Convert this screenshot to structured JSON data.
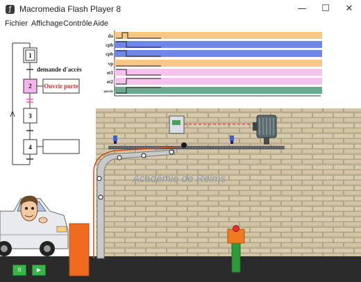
{
  "window": {
    "title": "Macromedia Flash Player 8",
    "app_icon": "flash-icon",
    "controls": {
      "minimize": "—",
      "maximize": "☐",
      "close": "✕"
    }
  },
  "menu": {
    "items": [
      "Fichier",
      "Affichage",
      "Contrôle",
      "Aide"
    ]
  },
  "grafcet": {
    "steps": [
      "1",
      "2",
      "3",
      "4"
    ],
    "transition_1": "demande d'accès",
    "action_2": "Ouvrir porte",
    "action_4": ""
  },
  "chronogram": {
    "signals": [
      {
        "label": "da",
        "color": "#f7c78a"
      },
      {
        "label": "cph",
        "color": "#6f87e8"
      },
      {
        "label": "cpb",
        "color": "#6f87e8"
      },
      {
        "label": "vp",
        "color": "#f7c78a"
      },
      {
        "label": "et1",
        "color": "#f6c3ee"
      },
      {
        "label": "et2",
        "color": "#f6c3ee"
      },
      {
        "label": "ouvrir",
        "color": "#6aaa8e"
      }
    ]
  },
  "scene": {
    "watermark": "Académie de Reims"
  },
  "controls": {
    "pause": "II",
    "play": "▶"
  },
  "colors": {
    "wall": "#cfc2a3",
    "ground": "#2b2b2b",
    "step_active": "#f5b4f0",
    "action_red": "#e03030",
    "barrier": "#f06a20",
    "post_green": "#2f9a3a"
  }
}
